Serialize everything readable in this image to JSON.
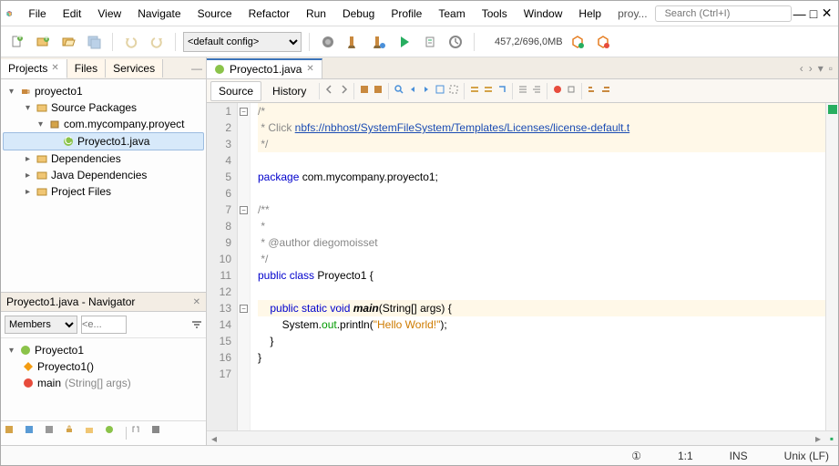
{
  "menu": [
    "File",
    "Edit",
    "View",
    "Navigate",
    "Source",
    "Refactor",
    "Run",
    "Debug",
    "Profile",
    "Team",
    "Tools",
    "Window",
    "Help"
  ],
  "project_short": "proy...",
  "search_placeholder": "Search (Ctrl+I)",
  "config": "<default config>",
  "memory": "457,2/696,0MB",
  "left_tabs": [
    "Projects",
    "Files",
    "Services"
  ],
  "tree": {
    "root": "proyecto1",
    "pkg_label": "Source Packages",
    "pkg_name": "com.mycompany.proyect",
    "file": "Proyecto1.java",
    "deps": "Dependencies",
    "jdeps": "Java Dependencies",
    "pfiles": "Project Files"
  },
  "navigator": {
    "title": "Proyecto1.java - Navigator",
    "filter": "Members",
    "placeholder": "<e...",
    "class": "Proyecto1",
    "ctor": "Proyecto1()",
    "method": "main",
    "method_args": "(String[] args)"
  },
  "editor": {
    "tab": "Proyecto1.java",
    "modes": [
      "Source",
      "History"
    ],
    "lines": {
      "l1": "/*",
      "l2_pre": " * Click ",
      "l2_link": "nbfs://nbhost/SystemFileSystem/Templates/Licenses/license-default.t",
      "l3": " */",
      "l5_kw": "package",
      "l5_rest": " com.mycompany.proyecto1;",
      "l7": "/**",
      "l8": " *",
      "l9": " * @author diegomoisset",
      "l10": " */",
      "l11_kw": "public class",
      "l11_name": " Proyecto1 ",
      "l11_brace": "{",
      "l13_pre": "    ",
      "l13_kw": "public static void",
      "l13_name": " main",
      "l13_args": "(String[] args) {",
      "l14_pre": "        System.",
      "l14_out": "out",
      "l14_mid": ".println(",
      "l14_str": "\"Hello World!\"",
      "l14_end": ");",
      "l15": "    }",
      "l16": "}"
    }
  },
  "status": {
    "notif": "①",
    "pos": "1:1",
    "ins": "INS",
    "eol": "Unix (LF)"
  }
}
